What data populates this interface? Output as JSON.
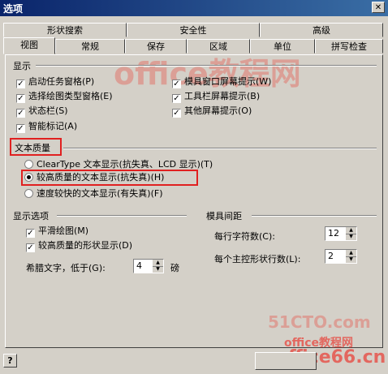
{
  "window": {
    "title": "选项",
    "close_glyph": "✕"
  },
  "tabs_back": [
    "形状搜索",
    "安全性",
    "高级"
  ],
  "tabs_front": [
    "视图",
    "常规",
    "保存",
    "区域",
    "单位",
    "拼写检查"
  ],
  "display": {
    "label": "显示",
    "left": [
      "启动任务窗格(P)",
      "选择绘图类型窗格(E)",
      "状态栏(S)",
      "智能标记(A)"
    ],
    "right": [
      "模具窗口屏幕提示(W)",
      "工具栏屏幕提示(B)",
      "其他屏幕提示(O)"
    ]
  },
  "text_quality": {
    "label": "文本质量",
    "options": [
      "ClearType 文本显示(抗失真、LCD 显示)(T)",
      "较高质量的文本显示(抗失真)(H)",
      "速度较快的文本显示(有失真)(F)"
    ],
    "selected_index": 1
  },
  "display_options": {
    "label": "显示选项",
    "checks": [
      "平滑绘图(M)",
      "较高质量的形状显示(D)"
    ],
    "greek_label": "希腊文字，低于(G):",
    "greek_value": "4",
    "greek_unit": "磅"
  },
  "stencil_spacing": {
    "label": "模具间距",
    "per_row_label": "每行字符数(C):",
    "per_row_value": "12",
    "per_master_label": "每个主控形状行数(L):",
    "per_master_value": "2"
  },
  "help_glyph": "?",
  "watermarks": [
    "51CTO.com",
    "office教程网",
    "office66.cn"
  ],
  "colors": {
    "highlight": "#e02020",
    "titlebar": "#0a246a"
  }
}
